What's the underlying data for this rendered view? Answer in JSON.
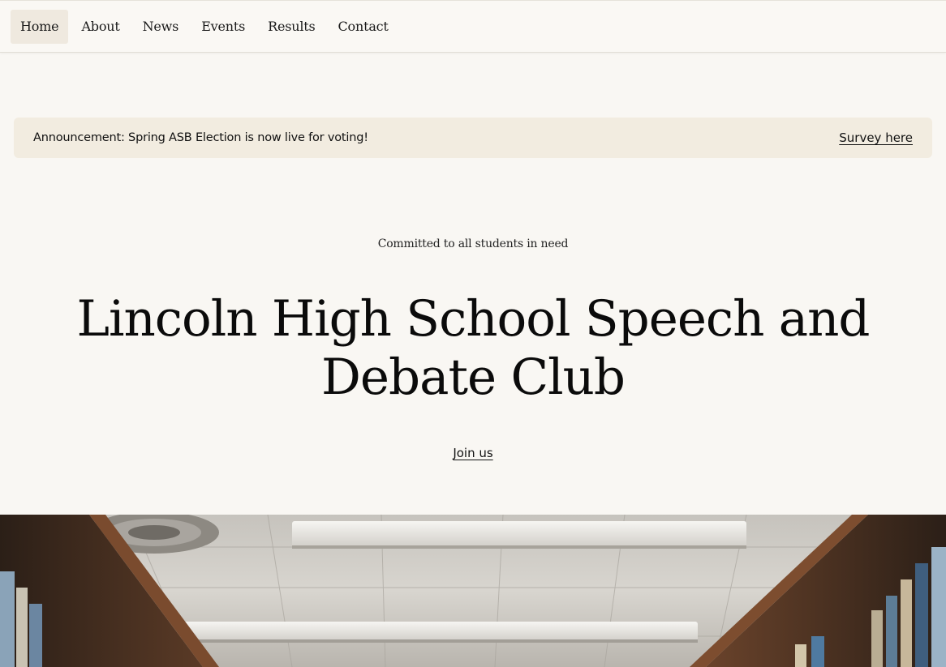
{
  "nav": {
    "items": [
      {
        "label": "Home",
        "active": true
      },
      {
        "label": "About"
      },
      {
        "label": "News"
      },
      {
        "label": "Events"
      },
      {
        "label": "Results"
      },
      {
        "label": "Contact"
      }
    ]
  },
  "announcement": {
    "text": "Announcement: Spring ASB Election is now live for voting!",
    "link_label": "Survey here"
  },
  "hero": {
    "tagline": "Committed to all students in need",
    "title": "Lincoln High School Speech and Debate Club",
    "cta_label": "Join us"
  },
  "colors": {
    "page_background": "#f9f7f3",
    "announcement_background": "#f2ece0",
    "active_nav_background": "#efe9df",
    "text": "#111111"
  }
}
